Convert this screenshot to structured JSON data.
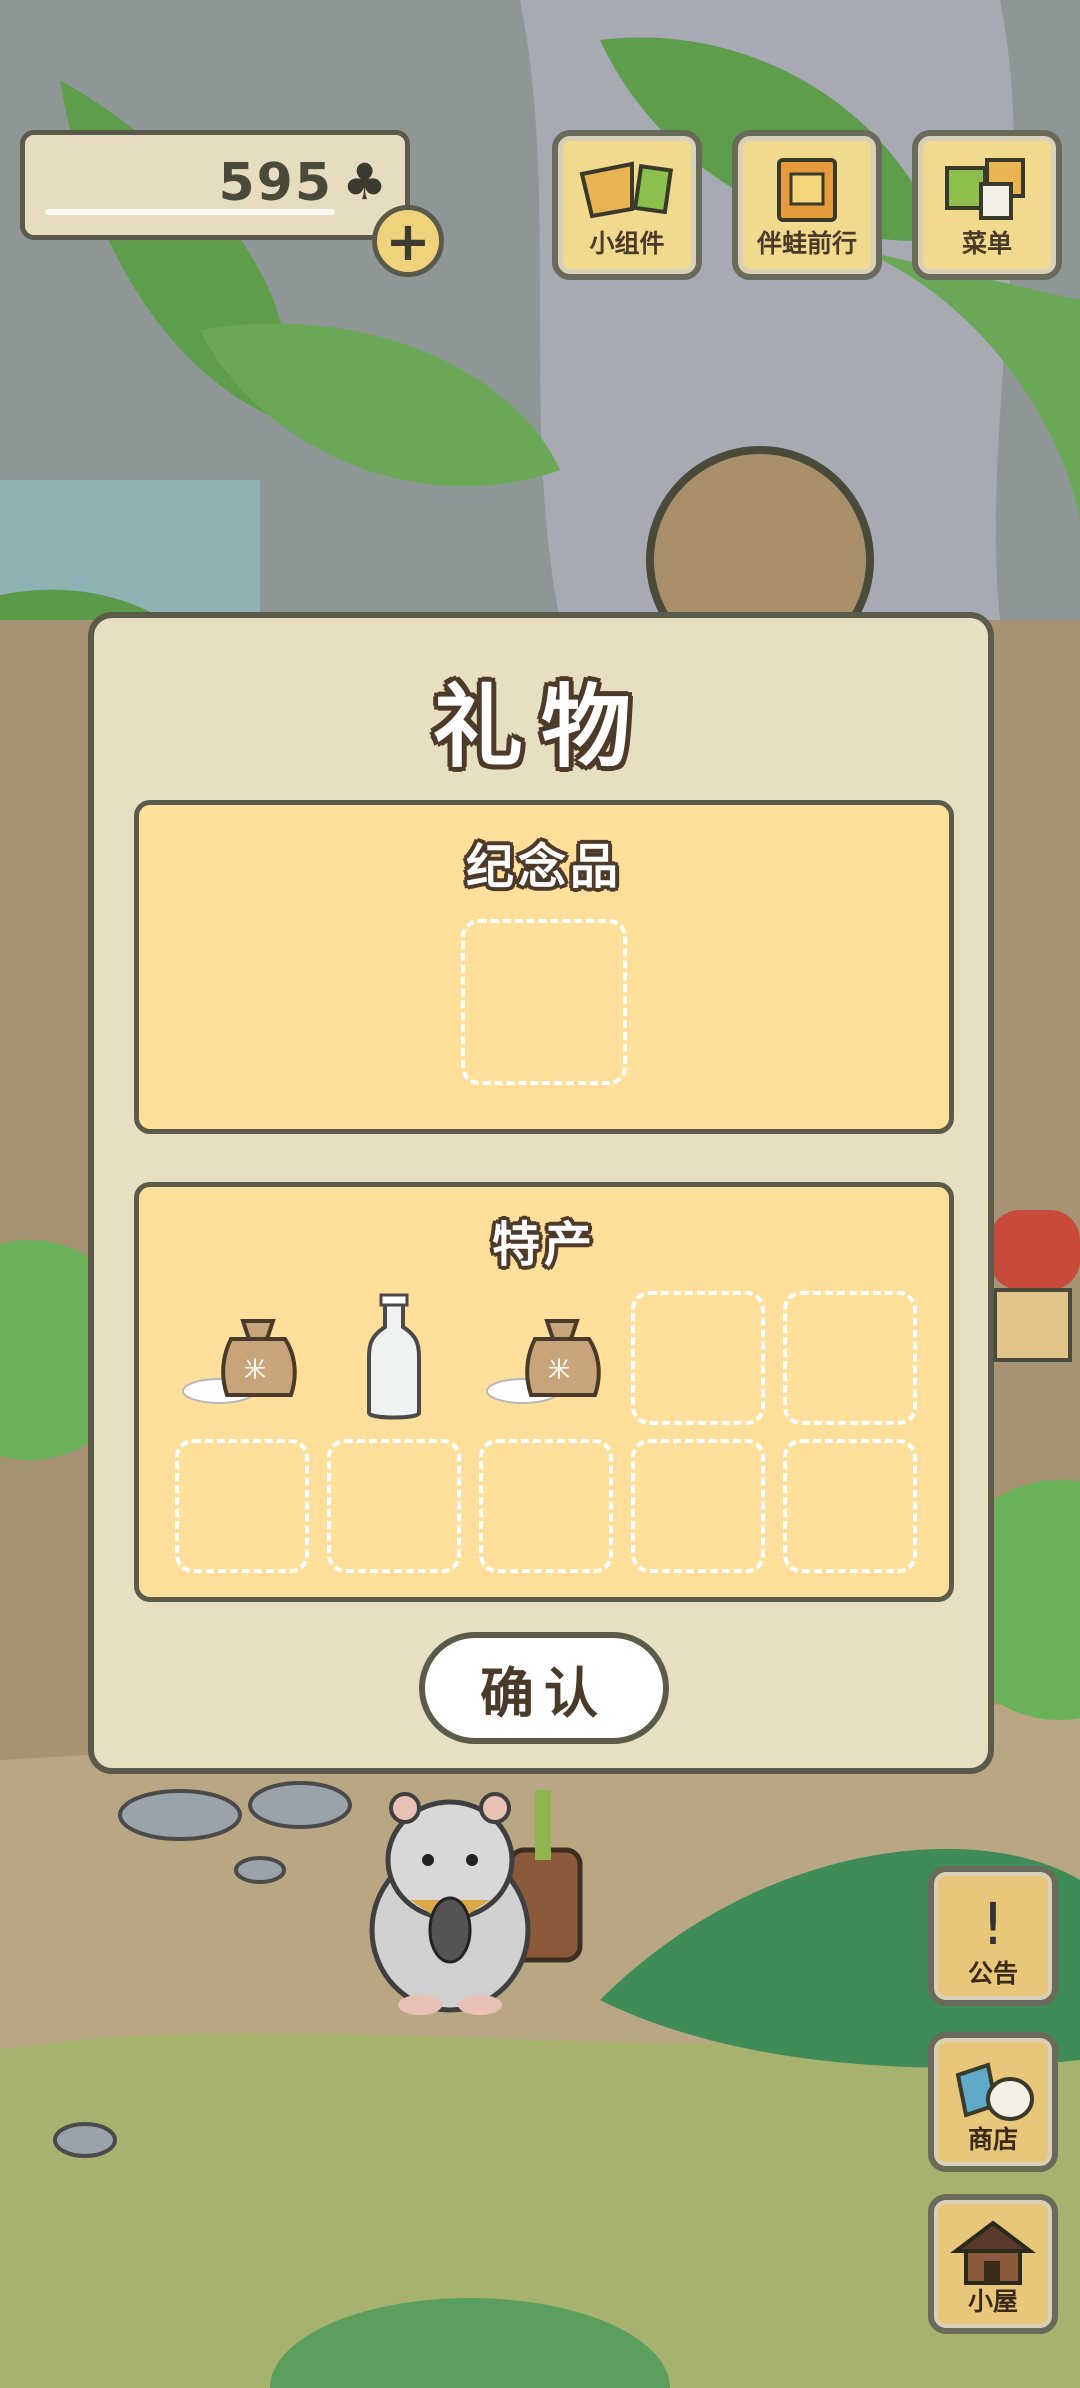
{
  "hud": {
    "clover_count": "595",
    "clover_icon": "clover-icon",
    "add_icon": "plus-icon",
    "top_buttons": [
      {
        "label": "小组件",
        "icon": "widget-icon"
      },
      {
        "label": "伴蛙前行",
        "icon": "journey-book-icon"
      },
      {
        "label": "菜单",
        "icon": "menu-cards-icon"
      }
    ],
    "side_buttons": [
      {
        "label": "公告",
        "icon": "exclamation-icon"
      },
      {
        "label": "商店",
        "icon": "shop-bags-icon"
      },
      {
        "label": "小屋",
        "icon": "house-icon"
      }
    ]
  },
  "dialog": {
    "title": "礼物",
    "souvenir": {
      "title": "纪念品",
      "slots": 1
    },
    "specialty": {
      "title": "特产",
      "items": [
        {
          "icon": "rice-sack-icon"
        },
        {
          "icon": "glass-bottle-icon"
        },
        {
          "icon": "rice-sack-icon"
        }
      ],
      "empty_slots": 7
    },
    "confirm_label": "确认"
  },
  "colors": {
    "panel": "#ffdf9a",
    "dialog": "#e7dfc1",
    "outline": "#5b5b4b",
    "button_wood": "#f1d98e"
  }
}
